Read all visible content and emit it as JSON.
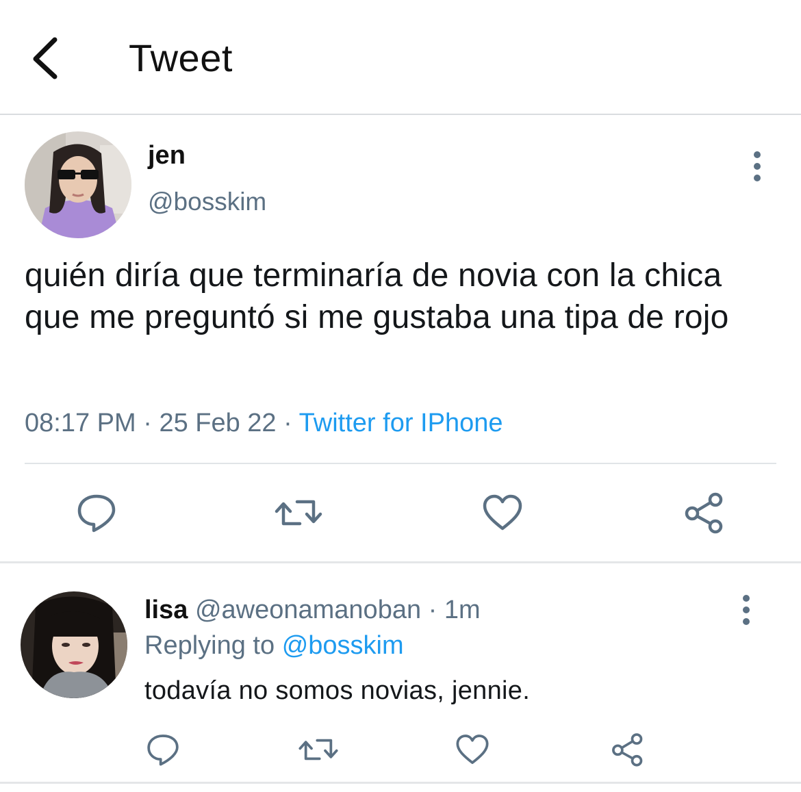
{
  "header": {
    "title": "Tweet",
    "back_icon": "chevron-left-icon"
  },
  "tweet": {
    "author_name": "jen",
    "author_handle": "@bosskim",
    "text": "quién diría que terminaría de novia con la chica que me preguntó si me gustaba una tipa de rojo",
    "time": "08:17 PM",
    "separator": "·",
    "date": "25 Feb 22",
    "source": "Twitter for IPhone",
    "actions": [
      "reply-icon",
      "retweet-icon",
      "like-icon",
      "share-icon"
    ]
  },
  "reply": {
    "author_name": "lisa",
    "author_handle": "@aweonamanoban",
    "separator": "·",
    "time_ago": "1m",
    "replying_prefix": "Replying to",
    "replying_to": "@bosskim",
    "text": "todavía no somos novias, jennie.",
    "actions": [
      "reply-icon",
      "retweet-icon",
      "like-icon",
      "share-icon"
    ]
  },
  "colors": {
    "accent": "#1d9bf0",
    "secondary_text": "#5b7083",
    "icon": "#5b7083",
    "divider": "#e1e4e7"
  }
}
